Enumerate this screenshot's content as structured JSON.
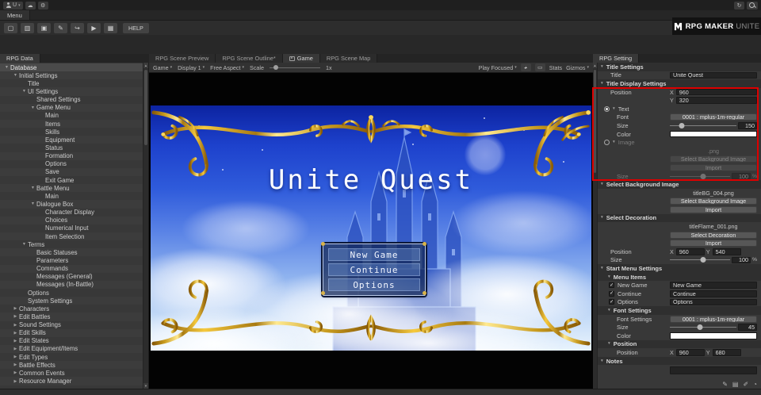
{
  "topbar": {
    "account_label": "U",
    "icons": {
      "cloud": "☁",
      "gear": "⚙",
      "history": "↻"
    }
  },
  "menu_tab": "Menu",
  "toolbar": {
    "icons": [
      {
        "name": "new-file-icon",
        "glyph": "▢"
      },
      {
        "name": "open-project-icon",
        "glyph": "▥"
      },
      {
        "name": "save-icon",
        "glyph": "▣"
      },
      {
        "name": "edit-pencil-icon",
        "glyph": "✎"
      },
      {
        "name": "import-export-icon",
        "glyph": "↪"
      },
      {
        "name": "play-icon",
        "glyph": "▶"
      },
      {
        "name": "tilemap-icon",
        "glyph": "▦"
      }
    ],
    "help_label": "HELP"
  },
  "logo": {
    "brand": "RPG MAKER",
    "product": "UNITE"
  },
  "left_panel": {
    "tab": "RPG Data",
    "tree": [
      {
        "label": "Database",
        "level": 0,
        "arrow": "open",
        "selected": true
      },
      {
        "label": "Initial Settings",
        "level": 1,
        "arrow": "open"
      },
      {
        "label": "Title",
        "level": 2,
        "arrow": "none"
      },
      {
        "label": "UI Settings",
        "level": 2,
        "arrow": "open"
      },
      {
        "label": "Shared Settings",
        "level": 3,
        "arrow": "none"
      },
      {
        "label": "Game Menu",
        "level": 3,
        "arrow": "open"
      },
      {
        "label": "Main",
        "level": 4,
        "arrow": "none"
      },
      {
        "label": "Items",
        "level": 4,
        "arrow": "none"
      },
      {
        "label": "Skills",
        "level": 4,
        "arrow": "none"
      },
      {
        "label": "Equipment",
        "level": 4,
        "arrow": "none"
      },
      {
        "label": "Status",
        "level": 4,
        "arrow": "none"
      },
      {
        "label": "Formation",
        "level": 4,
        "arrow": "none"
      },
      {
        "label": "Options",
        "level": 4,
        "arrow": "none"
      },
      {
        "label": "Save",
        "level": 4,
        "arrow": "none"
      },
      {
        "label": "Exit Game",
        "level": 4,
        "arrow": "none"
      },
      {
        "label": "Battle Menu",
        "level": 3,
        "arrow": "open"
      },
      {
        "label": "Main",
        "level": 4,
        "arrow": "none"
      },
      {
        "label": "Dialogue Box",
        "level": 3,
        "arrow": "open"
      },
      {
        "label": "Character Display",
        "level": 4,
        "arrow": "none"
      },
      {
        "label": "Choices",
        "level": 4,
        "arrow": "none"
      },
      {
        "label": "Numerical Input",
        "level": 4,
        "arrow": "none"
      },
      {
        "label": "Item Selection",
        "level": 4,
        "arrow": "none"
      },
      {
        "label": "Terms",
        "level": 2,
        "arrow": "open"
      },
      {
        "label": "Basic Statuses",
        "level": 3,
        "arrow": "none"
      },
      {
        "label": "Parameters",
        "level": 3,
        "arrow": "none"
      },
      {
        "label": "Commands",
        "level": 3,
        "arrow": "none"
      },
      {
        "label": "Messages (General)",
        "level": 3,
        "arrow": "none"
      },
      {
        "label": "Messages (In-Battle)",
        "level": 3,
        "arrow": "none"
      },
      {
        "label": "Options",
        "level": 2,
        "arrow": "none"
      },
      {
        "label": "System Settings",
        "level": 2,
        "arrow": "none"
      },
      {
        "label": "Characters",
        "level": 1,
        "arrow": "closed"
      },
      {
        "label": "Edit Battles",
        "level": 1,
        "arrow": "closed"
      },
      {
        "label": "Sound Settings",
        "level": 1,
        "arrow": "closed"
      },
      {
        "label": "Edit Skills",
        "level": 1,
        "arrow": "closed"
      },
      {
        "label": "Edit States",
        "level": 1,
        "arrow": "closed"
      },
      {
        "label": "Edit Equipment/Items",
        "level": 1,
        "arrow": "closed"
      },
      {
        "label": "Edit Types",
        "level": 1,
        "arrow": "closed"
      },
      {
        "label": "Battle Effects",
        "level": 1,
        "arrow": "closed"
      },
      {
        "label": "Common Events",
        "level": 1,
        "arrow": "closed"
      },
      {
        "label": "Resource Manager",
        "level": 1,
        "arrow": "closed"
      }
    ]
  },
  "center": {
    "tabs": [
      {
        "label": "RPG Scene Preview",
        "active": false
      },
      {
        "label": "RPG Scene Outline*",
        "active": false
      },
      {
        "label": "Game",
        "active": true,
        "icon": "game-view-icon"
      },
      {
        "label": "RPG Scene Map",
        "active": false
      }
    ],
    "game_toolbar": {
      "display_target": "Game",
      "display": "Display 1",
      "aspect": "Free Aspect",
      "scale_label": "Scale",
      "scale_value": "1x",
      "play_mode": "Play Focused",
      "stats_label": "Stats",
      "gizmos_label": "Gizmos"
    }
  },
  "game": {
    "title": "Unite Quest",
    "menu_items": [
      "New Game",
      "Continue",
      "Options"
    ]
  },
  "right_panel": {
    "tab": "RPG Setting",
    "highlight_color": "#dd0000",
    "rows": [
      {
        "t": "header",
        "level": 0,
        "label": "Title Settings"
      },
      {
        "t": "field",
        "level": 1,
        "label": "Title",
        "ctl": "input",
        "value": "Unite Quest"
      },
      {
        "t": "header",
        "level": 0,
        "label": "Title Display Settings"
      },
      {
        "t": "field",
        "level": 1,
        "label": "Position",
        "ctl": "x",
        "value": "960"
      },
      {
        "t": "field",
        "level": 1,
        "label": "",
        "ctl": "y",
        "value": "320"
      },
      {
        "t": "radio",
        "label": "Text",
        "checked": true
      },
      {
        "t": "field",
        "level": 2,
        "label": "Font",
        "ctl": "button",
        "value": "0001 : mplus-1m-regular"
      },
      {
        "t": "field",
        "level": 2,
        "label": "Size",
        "ctl": "slider",
        "value": "150",
        "pos": 18,
        "suffix": ""
      },
      {
        "t": "field",
        "level": 2,
        "label": "Color",
        "ctl": "color",
        "value": "#ffffff"
      },
      {
        "t": "radio",
        "label": "Image",
        "checked": false,
        "disabled": true
      },
      {
        "t": "center",
        "label": ".png",
        "disabled": true
      },
      {
        "t": "btnrow",
        "label": "Select Background Image",
        "disabled": true
      },
      {
        "t": "btnrow",
        "label": "Import",
        "disabled": true
      },
      {
        "t": "field",
        "level": 2,
        "label": "Size",
        "ctl": "slider",
        "value": "100",
        "pos": 55,
        "suffix": "%",
        "disabled": true
      },
      {
        "t": "header",
        "level": 0,
        "label": "Select Background Image"
      },
      {
        "t": "center",
        "label": "titleBG_004.png"
      },
      {
        "t": "btnrow",
        "label": "Select Background Image"
      },
      {
        "t": "btnrow",
        "label": "Import"
      },
      {
        "t": "header",
        "level": 0,
        "label": "Select Decoration"
      },
      {
        "t": "center",
        "label": "titleFlame_001.png"
      },
      {
        "t": "btnrow",
        "label": "Select Decoration"
      },
      {
        "t": "btnrow",
        "label": "Import"
      },
      {
        "t": "field",
        "level": 1,
        "label": "Position",
        "ctl": "xy",
        "x": "960",
        "y": "540"
      },
      {
        "t": "field",
        "level": 1,
        "label": "Size",
        "ctl": "slider",
        "value": "100",
        "pos": 55,
        "suffix": "%"
      },
      {
        "t": "header",
        "level": 0,
        "label": "Start Menu Settings"
      },
      {
        "t": "header",
        "level": 1,
        "label": "Menu Items"
      },
      {
        "t": "field",
        "level": 2,
        "label": "New Game",
        "check": true,
        "ctl": "input",
        "value": "New Game"
      },
      {
        "t": "field",
        "level": 2,
        "label": "Continue",
        "check": true,
        "ctl": "input",
        "value": "Continue"
      },
      {
        "t": "field",
        "level": 2,
        "label": "Options",
        "check": true,
        "ctl": "input",
        "value": "Options"
      },
      {
        "t": "header",
        "level": 1,
        "label": "Font Settings"
      },
      {
        "t": "field",
        "level": 2,
        "label": "Font Settings",
        "ctl": "button",
        "value": "0001 : mplus-1m-regular"
      },
      {
        "t": "field",
        "level": 2,
        "label": "Size",
        "ctl": "slider",
        "value": "45",
        "pos": 45,
        "suffix": ""
      },
      {
        "t": "field",
        "level": 2,
        "label": "Color",
        "ctl": "color",
        "value": "#ffffff"
      },
      {
        "t": "header",
        "level": 1,
        "label": "Position"
      },
      {
        "t": "field",
        "level": 2,
        "label": "Position",
        "ctl": "xy",
        "x": "960",
        "y": "680"
      },
      {
        "t": "header",
        "level": 0,
        "label": "Notes"
      },
      {
        "t": "textarea"
      }
    ]
  },
  "status_icons": [
    {
      "name": "scene-paint-icon",
      "glyph": "✎"
    },
    {
      "name": "notes-panel-icon",
      "glyph": "▤"
    },
    {
      "name": "edit-mode-icon",
      "glyph": "✐"
    },
    {
      "name": "sync-status-icon",
      "glyph": "◔"
    }
  ]
}
